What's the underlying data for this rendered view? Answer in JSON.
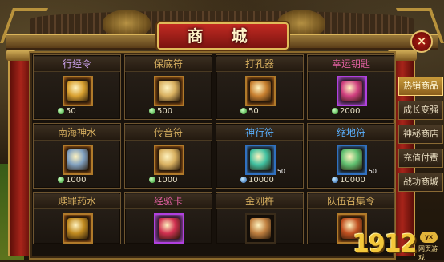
{
  "window": {
    "title": "商 城",
    "close_label": "×"
  },
  "items": [
    {
      "name": "行经令",
      "name_color": "#c8a0e8",
      "price": "50",
      "currency": "green",
      "icon": "token-icon",
      "frame": "orange",
      "icon_color": "#d8a030"
    },
    {
      "name": "保底符",
      "name_color": "#d8b060",
      "price": "500",
      "currency": "green",
      "icon": "talisman-scroll-icon",
      "frame": "orange",
      "icon_color": "#d8b060"
    },
    {
      "name": "打孔器",
      "name_color": "#d8b060",
      "price": "50",
      "currency": "green",
      "icon": "drill-icon",
      "frame": "orange",
      "icon_color": "#c88030"
    },
    {
      "name": "幸运钥匙",
      "name_color": "#e060a0",
      "price": "2000",
      "currency": "green",
      "icon": "key-icon",
      "frame": "purple",
      "icon_color": "#d04080"
    },
    {
      "name": "南海神水",
      "name_color": "#d8b060",
      "price": "1000",
      "currency": "green",
      "icon": "water-bottle-icon",
      "frame": "orange",
      "icon_color": "#80a0c0"
    },
    {
      "name": "传音符",
      "name_color": "#d8b060",
      "price": "1000",
      "currency": "green",
      "icon": "scroll-icon",
      "frame": "orange",
      "icon_color": "#d8b060"
    },
    {
      "name": "神行符",
      "name_color": "#5ab0ff",
      "price": "10000",
      "currency": "blue",
      "icon": "blue-talisman-icon",
      "frame": "blue",
      "icon_color": "#40c0a0",
      "count": "50"
    },
    {
      "name": "缩地符",
      "name_color": "#5ab0ff",
      "price": "10000",
      "currency": "blue",
      "icon": "green-talisman-icon",
      "frame": "blue",
      "icon_color": "#60c070",
      "count": "50"
    },
    {
      "name": "赎罪药水",
      "name_color": "#d8b060",
      "icon": "potion-icon",
      "frame": "orange",
      "icon_color": "#c08a20"
    },
    {
      "name": "经验卡",
      "name_color": "#e060a0",
      "icon": "exp-card-icon",
      "frame": "purple",
      "icon_color": "#d03050"
    },
    {
      "name": "金刚杵",
      "name_color": "#d8b060",
      "icon": "vajra-icon",
      "frame": "none",
      "icon_color": "#c08040"
    },
    {
      "name": "队伍召集令",
      "name_color": "#d8b060",
      "icon": "summon-token-icon",
      "frame": "orange",
      "icon_color": "#c05020"
    }
  ],
  "tabs": [
    {
      "label": "热销商品",
      "active": true
    },
    {
      "label": "成长变强",
      "active": false
    },
    {
      "label": "神秘商店",
      "active": false
    },
    {
      "label": "充值付费",
      "active": false
    },
    {
      "label": "战功商城",
      "active": false
    }
  ],
  "logo": {
    "digits": "1912",
    "badge": "yx",
    "sub": "网页游戏"
  }
}
